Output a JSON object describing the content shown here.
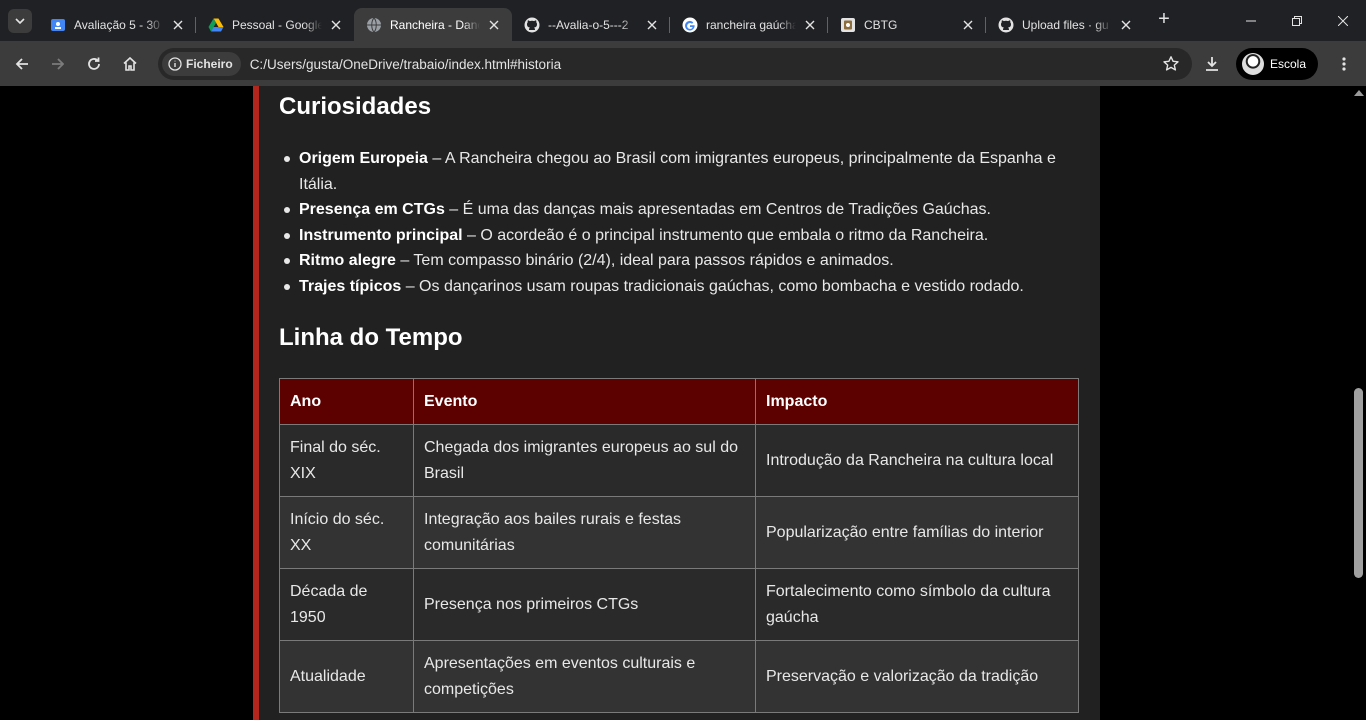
{
  "tabs": [
    {
      "title": "Avaliação 5 - 30",
      "icon": "google-classroom-icon",
      "active": false
    },
    {
      "title": "Pessoal - Google Drive",
      "icon": "google-drive-icon",
      "active": false
    },
    {
      "title": "Rancheira - Dança",
      "icon": "globe-icon",
      "active": true
    },
    {
      "title": "--Avalia-o-5---2",
      "icon": "github-icon",
      "active": false
    },
    {
      "title": "rancheira gaúcha",
      "icon": "google-icon",
      "active": false
    },
    {
      "title": "CBTG",
      "icon": "cbtg-logo-icon",
      "active": false
    },
    {
      "title": "Upload files · gu",
      "icon": "github-icon",
      "active": false
    }
  ],
  "toolbar": {
    "site_chip": "Ficheiro",
    "url": "C:/Users/gusta/OneDrive/trabaio/index.html#historia",
    "profile_label": "Escola"
  },
  "page": {
    "curiosidades_title": "Curiosidades",
    "curiosidades": [
      {
        "term": "Origem Europeia",
        "text": " – A Rancheira chegou ao Brasil com imigrantes europeus, principalmente da Espanha e Itália."
      },
      {
        "term": "Presença em CTGs",
        "text": " – É uma das danças mais apresentadas em Centros de Tradições Gaúchas."
      },
      {
        "term": "Instrumento principal",
        "text": " – O acordeão é o principal instrumento que embala o ritmo da Rancheira."
      },
      {
        "term": "Ritmo alegre",
        "text": " – Tem compasso binário (2/4), ideal para passos rápidos e animados."
      },
      {
        "term": "Trajes típicos",
        "text": " – Os dançarinos usam roupas tradicionais gaúchas, como bombacha e vestido rodado."
      }
    ],
    "timeline_title": "Linha do Tempo",
    "table": {
      "headers": [
        "Ano",
        "Evento",
        "Impacto"
      ],
      "rows": [
        [
          "Final do séc. XIX",
          "Chegada dos imigrantes europeus ao sul do Brasil",
          "Introdução da Rancheira na cultura local"
        ],
        [
          "Início do séc. XX",
          "Integração aos bailes rurais e festas comunitárias",
          "Popularização entre famílias do interior"
        ],
        [
          "Década de 1950",
          "Presença nos primeiros CTGs",
          "Fortalecimento como símbolo da cultura gaúcha"
        ],
        [
          "Atualidade",
          "Apresentações em eventos culturais e competições",
          "Preservação e valorização da tradição"
        ]
      ]
    }
  },
  "colors": {
    "accent_border": "#b3261e",
    "table_header": "#5c0000",
    "content_bg": "#212121"
  }
}
